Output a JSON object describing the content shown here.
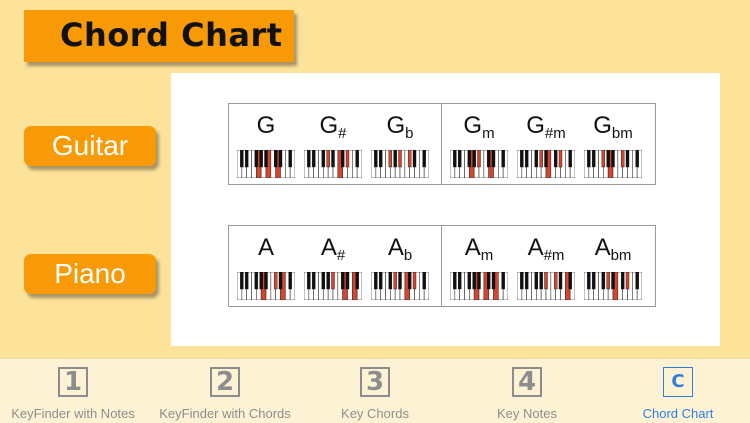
{
  "title": "Chord Chart",
  "buttons": {
    "guitar": "Guitar",
    "piano": "Piano"
  },
  "rows": [
    {
      "name": "G-row",
      "major": [
        {
          "root": "G",
          "suffix": "",
          "highlight": [
            7,
            11,
            14
          ]
        },
        {
          "root": "G",
          "suffix": "#",
          "highlight": [
            8,
            12,
            15
          ]
        },
        {
          "root": "G",
          "suffix": "b",
          "highlight": [
            6,
            10,
            13
          ]
        }
      ],
      "minor": [
        {
          "root": "G",
          "suffix": "m",
          "highlight": [
            7,
            10,
            14
          ]
        },
        {
          "root": "G",
          "suffix": "#m",
          "highlight": [
            8,
            11,
            15
          ]
        },
        {
          "root": "G",
          "suffix": "bm",
          "highlight": [
            6,
            9,
            13
          ]
        }
      ]
    },
    {
      "name": "A-row",
      "major": [
        {
          "root": "A",
          "suffix": "",
          "highlight": [
            9,
            13,
            16
          ]
        },
        {
          "root": "A",
          "suffix": "#",
          "highlight": [
            10,
            14,
            17
          ]
        },
        {
          "root": "A",
          "suffix": "b",
          "highlight": [
            8,
            12,
            15
          ]
        }
      ],
      "minor": [
        {
          "root": "A",
          "suffix": "m",
          "highlight": [
            9,
            12,
            16
          ]
        },
        {
          "root": "A",
          "suffix": "#m",
          "highlight": [
            10,
            13,
            17
          ]
        },
        {
          "root": "A",
          "suffix": "bm",
          "highlight": [
            8,
            11,
            15
          ]
        }
      ]
    }
  ],
  "tabs": [
    {
      "icon": "1",
      "label": "KeyFinder with Notes",
      "active": false
    },
    {
      "icon": "2",
      "label": "KeyFinder with Chords",
      "active": false
    },
    {
      "icon": "3",
      "label": "Key Chords",
      "active": false
    },
    {
      "icon": "4",
      "label": "Key Notes",
      "active": false
    },
    {
      "icon": "C",
      "label": "Chord Chart",
      "active": true
    }
  ],
  "colors": {
    "background": "#fde29a",
    "accent": "#f89a06",
    "highlight_key": "#d9452c",
    "active_tab": "#2f7fe0"
  }
}
